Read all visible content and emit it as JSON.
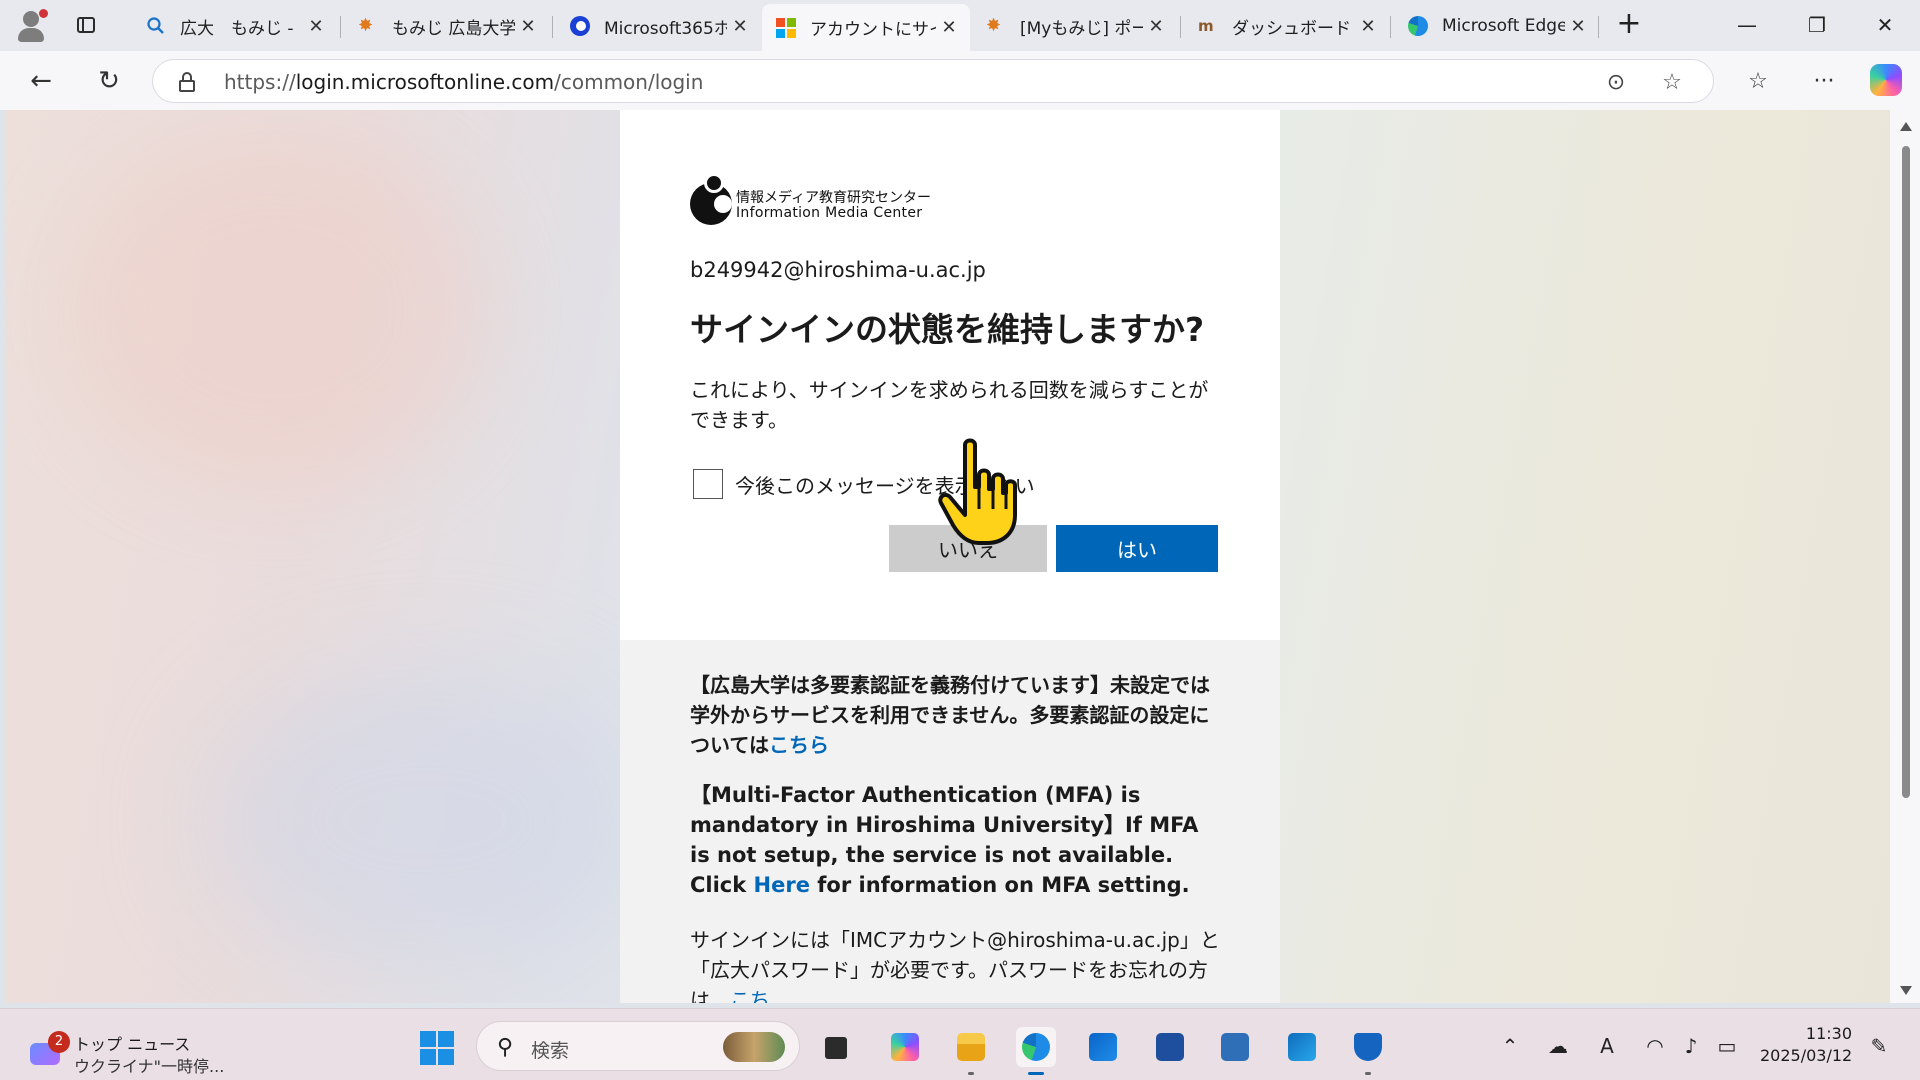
{
  "browser": {
    "tabs": [
      {
        "title": "広大　もみじ - ",
        "icon": "search-icon"
      },
      {
        "title": "もみじ 広島大学",
        "icon": "momiji-leaf-icon"
      },
      {
        "title": "Microsoft365ホ",
        "icon": "imc-logo-icon"
      },
      {
        "title": "アカウントにサイン",
        "icon": "microsoft-logo-icon",
        "active": true
      },
      {
        "title": "[Myもみじ] ポー",
        "icon": "momiji-leaf-icon"
      },
      {
        "title": "ダッシュボード",
        "icon": "moodle-icon"
      },
      {
        "title": "Microsoft Edge",
        "icon": "edge-icon"
      }
    ],
    "url": {
      "scheme": "https://",
      "host": "login.microsoftonline.com",
      "path": "/common/login"
    },
    "colors": {
      "accent": "#0067b8",
      "ms_red": "#f25022",
      "ms_green": "#7fba00",
      "ms_blue": "#00a4ef",
      "ms_yellow": "#ffb900"
    }
  },
  "signin": {
    "logo_jp": "情報メディア教育研究センター",
    "logo_en": "Information Media Center",
    "identity": "b249942@hiroshima-u.ac.jp",
    "heading": "サインインの状態を維持しますか?",
    "description": "これにより、サインインを求められる回数を減らすことができます。",
    "dont_show_label": "今後このメッセージを表示しない",
    "dont_show_checked": false,
    "no_button": "いいえ",
    "yes_button": "はい"
  },
  "banner": {
    "jp_text": "【広島大学は多要素認証を義務付けています】未設定では学外からサービスを利用できません。多要素認証の設定については",
    "jp_link": "こちら",
    "en_text": "【Multi-Factor Authentication (MFA) is mandatory in Hiroshima University】If MFA is not setup, the service is not available. Click ",
    "en_link": "Here",
    "en_text_after": " for information on MFA setting.",
    "info_text": "サインインには「IMCアカウント@hiroshima-u.ac.jp」と「広大パスワード」が必要です。パスワードをお忘れの方は、",
    "info_link": "こち"
  },
  "taskbar": {
    "news_badge": "2",
    "news_title": "トップ ニュース",
    "news_headline": "ウクライナ\"一時停...",
    "search_placeholder": "検索",
    "time": "11:30",
    "date": "2025/03/12"
  }
}
